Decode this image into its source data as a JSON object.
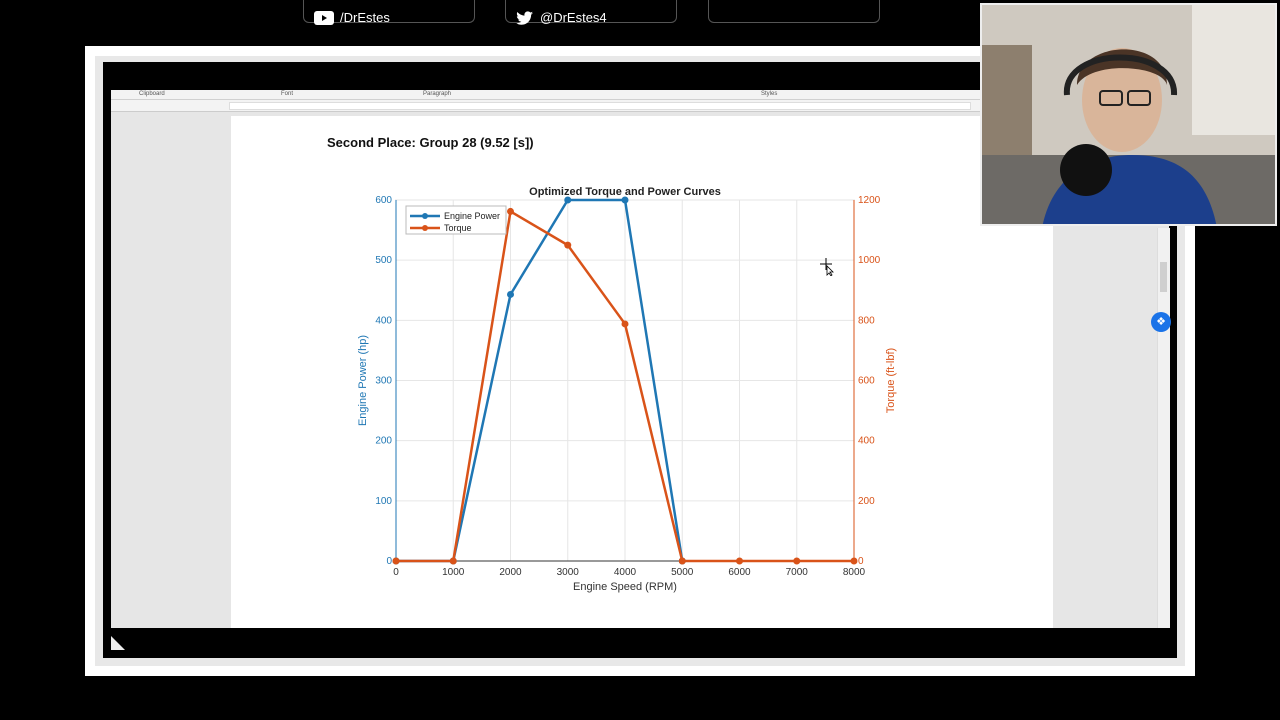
{
  "header": {
    "youtube": "/DrEstes",
    "twitter": "@DrEstes4"
  },
  "ribbon": {
    "groups": [
      "Clipboard",
      "Font",
      "Paragraph",
      "Styles"
    ]
  },
  "document": {
    "heading": "Second Place: Group 28 (9.52 [s])"
  },
  "colors": {
    "power": "#1f77b4",
    "torque": "#d95319",
    "background": "#000000"
  },
  "chart_data": {
    "type": "line",
    "title": "Optimized Torque and Power Curves",
    "xlabel": "Engine Speed (RPM)",
    "ylabel": "Engine Power (hp)",
    "y2label": "Torque (ft-lbf)",
    "xlim": [
      0,
      8000
    ],
    "ylim": [
      0,
      600
    ],
    "y2lim": [
      0,
      1200
    ],
    "xticks": [
      0,
      1000,
      2000,
      3000,
      4000,
      5000,
      6000,
      7000,
      8000
    ],
    "yticks": [
      0,
      100,
      200,
      300,
      400,
      500,
      600
    ],
    "y2ticks": [
      0,
      200,
      400,
      600,
      800,
      1000,
      1200
    ],
    "grid": true,
    "legend": "top-left",
    "series": [
      {
        "name": "Engine Power",
        "axis": "left",
        "color": "#1f77b4",
        "x": [
          0,
          1000,
          2000,
          3000,
          4000,
          5000
        ],
        "y": [
          0,
          0,
          443,
          600,
          600,
          0
        ]
      },
      {
        "name": "Torque",
        "axis": "right",
        "color": "#d95319",
        "x": [
          0,
          1000,
          2000,
          3000,
          4000,
          5000,
          6000,
          7000,
          8000
        ],
        "y": [
          0,
          0,
          1162,
          1050,
          788,
          0,
          0,
          0,
          0
        ]
      }
    ]
  }
}
